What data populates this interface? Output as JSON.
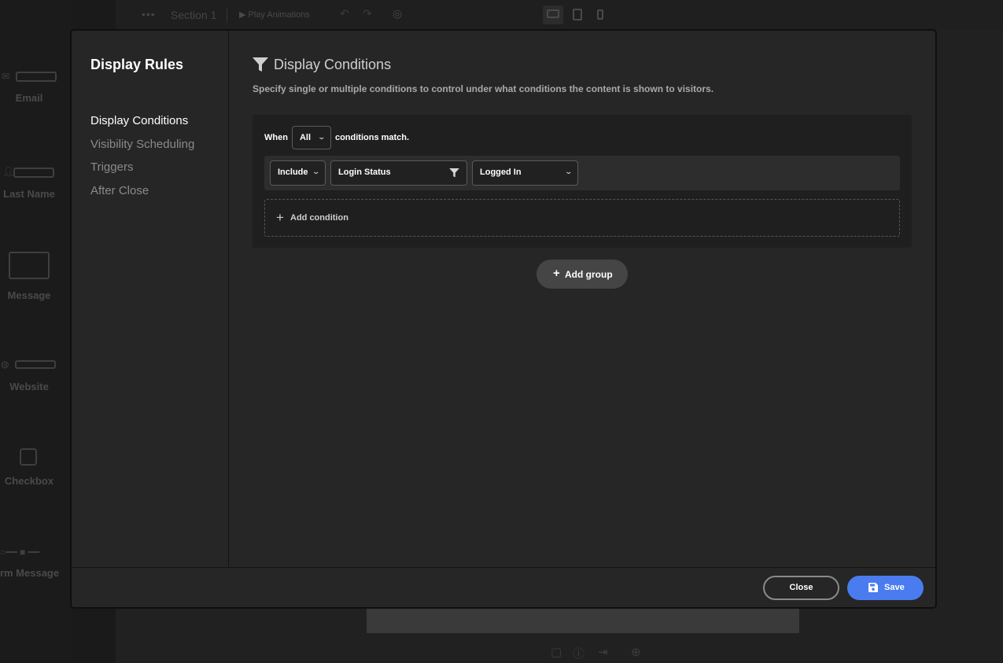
{
  "background": {
    "topbar": {
      "section_label": "Section 1",
      "play_label": "Play Animations"
    },
    "fields": [
      {
        "label": "Email"
      },
      {
        "label": "Last Name"
      },
      {
        "label": "Message"
      },
      {
        "label": "Website"
      },
      {
        "label": "Checkbox"
      },
      {
        "label": "orm Message"
      }
    ]
  },
  "sidebar": {
    "title": "Display Rules",
    "items": [
      {
        "label": "Display Conditions",
        "active": true
      },
      {
        "label": "Visibility Scheduling",
        "active": false
      },
      {
        "label": "Triggers",
        "active": false
      },
      {
        "label": "After Close",
        "active": false
      }
    ]
  },
  "main": {
    "title": "Display Conditions",
    "title_icon": "filter-icon",
    "description": "Specify single or multiple conditions to control under what conditions the content is shown to visitors.",
    "group": {
      "when_label": "When",
      "match_value": "All",
      "match_suffix": "conditions match.",
      "condition": {
        "mode": "Include",
        "field": "Login Status",
        "value": "Logged In"
      },
      "add_condition_label": "Add condition"
    },
    "add_group_label": "Add group"
  },
  "footer": {
    "close_label": "Close",
    "save_label": "Save"
  },
  "colors": {
    "accent": "#4a7cf0",
    "modal_bg": "#262626"
  }
}
